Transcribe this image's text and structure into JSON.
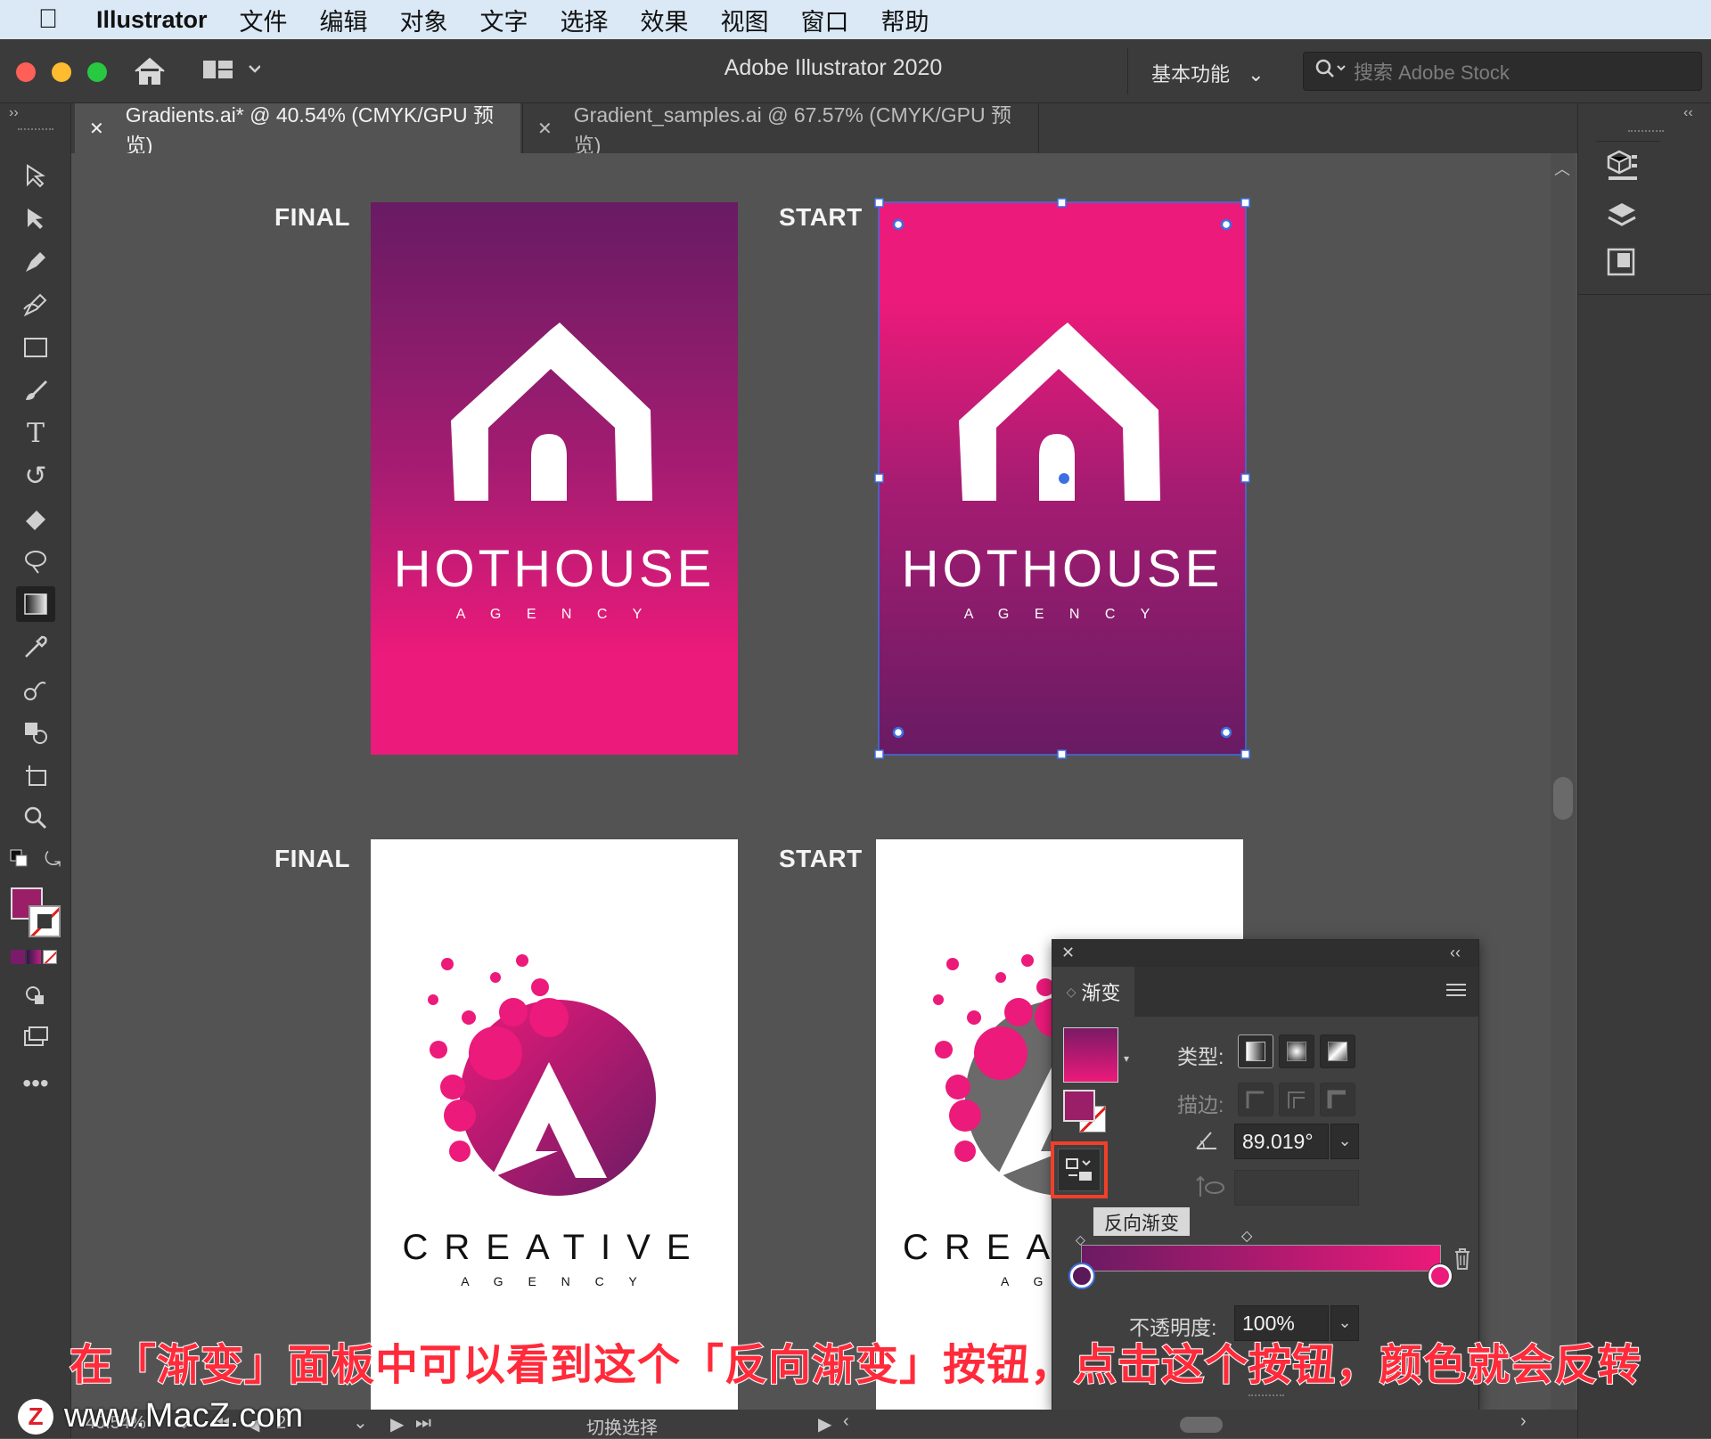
{
  "menubar": {
    "app_name": "Illustrator",
    "items": [
      "文件",
      "编辑",
      "对象",
      "文字",
      "选择",
      "效果",
      "视图",
      "窗口",
      "帮助"
    ]
  },
  "titlebar": {
    "title": "Adobe Illustrator 2020",
    "workspace": "基本功能",
    "stock_placeholder": "搜索 Adobe Stock"
  },
  "tabs": [
    {
      "label": "Gradients.ai* @ 40.54% (CMYK/GPU 预览)",
      "active": true
    },
    {
      "label": "Gradient_samples.ai @ 67.57% (CMYK/GPU 预览)",
      "active": false
    }
  ],
  "artboards": {
    "label_final": "FINAL",
    "label_start": "START",
    "hothouse_title": "HOTHOUSE",
    "hothouse_sub": "A G E N C Y",
    "creative_title": "CREATIVE",
    "creative_sub": "A G E N C Y",
    "creative_title_partial": "CREA",
    "creative_sub_partial": "A G E"
  },
  "colors": {
    "purple": "#6b1b63",
    "magenta": "#ec1a7a",
    "selection": "#3d6fe0",
    "caption": "#ff2a3a"
  },
  "gradient_panel": {
    "tab": "渐变",
    "type_label": "类型:",
    "stroke_label": "描边:",
    "angle": "89.019°",
    "reverse_tooltip": "反向渐变",
    "opacity_label": "不透明度:",
    "opacity": "100%"
  },
  "status": {
    "zoom": "40.54%",
    "page": "2",
    "mode": "切换选择"
  },
  "caption": "在「渐变」面板中可以看到这个「反向渐变」按钮，点击这个按钮，颜色就会反转",
  "watermark": "www.MacZ.com"
}
